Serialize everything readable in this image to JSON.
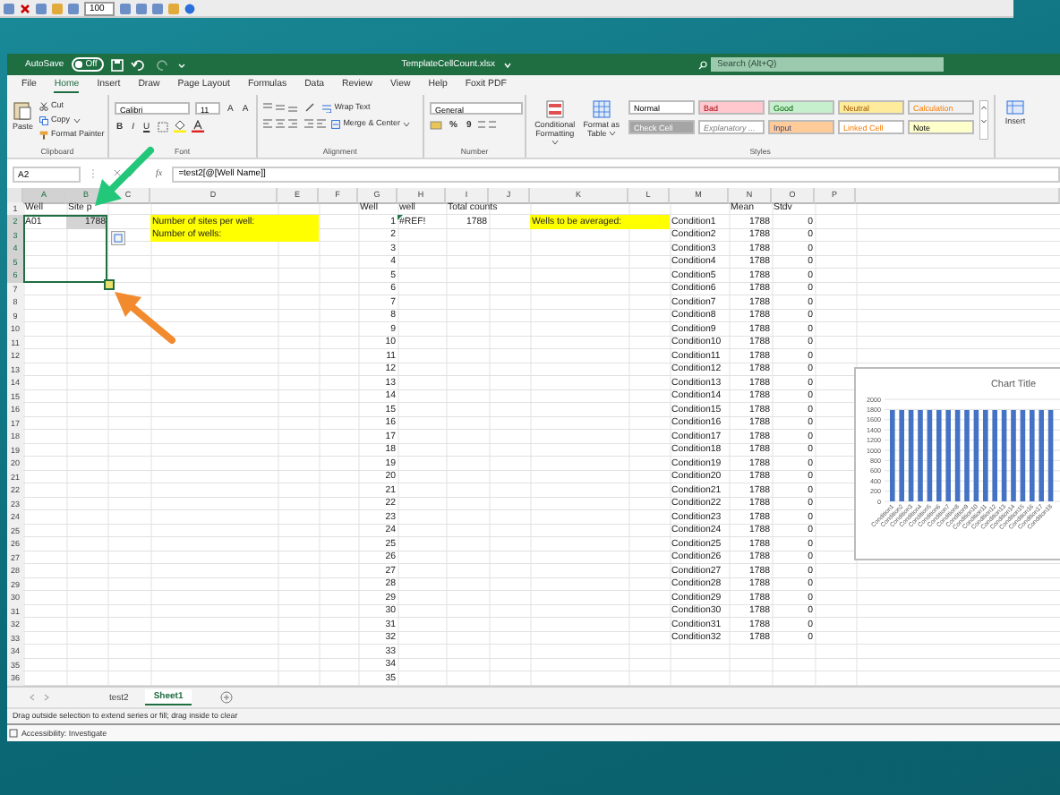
{
  "toolbar": {
    "zoom": "100"
  },
  "window": {
    "autosave_label": "AutoSave",
    "autosave_on": false,
    "autosave_state": "Off",
    "title": "TemplateCellCount.xlsx",
    "search": {
      "placeholder": "Search (Alt+Q)"
    }
  },
  "tabs": [
    {
      "label": "File",
      "selected": false
    },
    {
      "label": "Home",
      "selected": true
    },
    {
      "label": "Insert",
      "selected": false
    },
    {
      "label": "Draw",
      "selected": false
    },
    {
      "label": "Page Layout",
      "selected": false
    },
    {
      "label": "Formulas",
      "selected": false
    },
    {
      "label": "Data",
      "selected": false
    },
    {
      "label": "Review",
      "selected": false
    },
    {
      "label": "View",
      "selected": false
    },
    {
      "label": "Help",
      "selected": false
    },
    {
      "label": "Foxit PDF",
      "selected": false
    }
  ],
  "ribbon": {
    "clipboard": {
      "paste": "Paste",
      "cut": "Cut",
      "copy": "Copy",
      "format_painter": "Format Painter",
      "label": "Clipboard"
    },
    "font": {
      "family": "Calibri",
      "size": "11",
      "size_buttons": [
        "A",
        "A"
      ],
      "format_buttons": [
        "B",
        "I",
        "U"
      ],
      "label": "Font"
    },
    "alignment": {
      "wrap_text": "Wrap Text",
      "merge_center": "Merge & Center",
      "label": "Alignment"
    },
    "number": {
      "format": "General",
      "symbols": [
        "%",
        "9"
      ],
      "label": "Number"
    },
    "styles": {
      "conditional_formatting": "Conditional Formatting",
      "format_as_table": "Format as Table",
      "label": "Styles",
      "cell_styles": [
        {
          "label": "Normal",
          "kind": "normal",
          "color": "#ffffff"
        },
        {
          "label": "Bad",
          "kind": "bad",
          "color": "#ffc7ce"
        },
        {
          "label": "Good",
          "kind": "good",
          "color": "#c6efce"
        },
        {
          "label": "Neutral",
          "kind": "neutral",
          "color": "#ffeb9c"
        },
        {
          "label": "Calculation",
          "kind": "calculation",
          "color": "#f2f2f2"
        },
        {
          "label": "Check Cell",
          "kind": "check",
          "color": "#a5a5a5"
        },
        {
          "label": "Explanatory ...",
          "kind": "explanatory",
          "color": "#ffffff"
        },
        {
          "label": "Input",
          "kind": "input",
          "color": "#ffcc99"
        },
        {
          "label": "Linked Cell",
          "kind": "linked",
          "color": "#ffffff"
        },
        {
          "label": "Note",
          "kind": "note",
          "color": "#ffffcc"
        }
      ]
    },
    "cells": {
      "insert": "Insert"
    }
  },
  "formula_bar": {
    "name_box": "A2",
    "fx": "fx",
    "formula": "=test2[@[Well Name]]"
  },
  "sheet": {
    "columns": {
      "A": {
        "label": "A",
        "selected": true
      },
      "B": {
        "label": "B",
        "selected": true
      },
      "C": {
        "label": "C",
        "selected": false
      },
      "D": {
        "label": "D",
        "selected": false
      },
      "E": {
        "label": "E",
        "selected": false
      },
      "F": {
        "label": "F",
        "selected": false
      },
      "G": {
        "label": "G",
        "selected": false
      },
      "H": {
        "label": "H",
        "selected": false
      },
      "I": {
        "label": "I",
        "selected": false
      },
      "J": {
        "label": "J",
        "selected": false
      },
      "K": {
        "label": "K",
        "selected": false
      },
      "L": {
        "label": "L",
        "selected": false
      },
      "M": {
        "label": "M",
        "selected": false
      },
      "N": {
        "label": "N",
        "selected": false
      },
      "O": {
        "label": "O",
        "selected": false
      },
      "P": {
        "label": "P",
        "selected": false
      }
    },
    "rows": [
      {
        "label": "1",
        "selected": false,
        "cells": {
          "A": {
            "kind": "text",
            "text": "Well"
          },
          "B": {
            "kind": "text",
            "text": "Site p"
          },
          "G": {
            "kind": "text",
            "text": "Well"
          },
          "H": {
            "kind": "text",
            "text": "well"
          },
          "I": {
            "kind": "text",
            "text": "Total counts"
          },
          "N": {
            "kind": "text",
            "text": "Mean"
          },
          "O": {
            "kind": "text",
            "text": "Stdv"
          }
        }
      },
      {
        "label": "2",
        "selected": true,
        "cells": {
          "A": {
            "kind": "text",
            "text": "A01"
          },
          "B": {
            "kind": "number",
            "text": "1788",
            "color": "#d4d4d4"
          },
          "D": {
            "kind": "text",
            "text": "Number of sites per well:",
            "color": "#ffff00"
          },
          "E": {
            "kind": "fill",
            "color": "#ffff00"
          },
          "G": {
            "kind": "number",
            "text": "1"
          },
          "H": {
            "kind": "text",
            "text": "#REF!",
            "error": true
          },
          "I": {
            "kind": "number",
            "text": "1788"
          },
          "K": {
            "kind": "text",
            "text": "Wells to be averaged:",
            "color": "#ffff00"
          },
          "L": {
            "kind": "fill",
            "color": "#ffff00"
          },
          "M": {
            "kind": "text",
            "text": "Condition1"
          },
          "N": {
            "kind": "number",
            "text": "1788"
          },
          "O": {
            "kind": "number",
            "text": "0"
          }
        }
      },
      {
        "label": "3",
        "selected": true,
        "cells": {
          "D": {
            "kind": "text",
            "text": "Number of wells:",
            "color": "#ffff00"
          },
          "E": {
            "kind": "fill",
            "color": "#ffff00"
          },
          "G": {
            "kind": "number",
            "text": "2"
          },
          "M": {
            "kind": "text",
            "text": "Condition2"
          },
          "N": {
            "kind": "number",
            "text": "1788"
          },
          "O": {
            "kind": "number",
            "text": "0"
          }
        }
      },
      {
        "label": "4",
        "selected": true,
        "cells": {
          "G": {
            "kind": "number",
            "text": "3"
          },
          "M": {
            "kind": "text",
            "text": "Condition3"
          },
          "N": {
            "kind": "number",
            "text": "1788"
          },
          "O": {
            "kind": "number",
            "text": "0"
          }
        }
      },
      {
        "label": "5",
        "selected": true,
        "cells": {
          "G": {
            "kind": "number",
            "text": "4"
          },
          "M": {
            "kind": "text",
            "text": "Condition4"
          },
          "N": {
            "kind": "number",
            "text": "1788"
          },
          "O": {
            "kind": "number",
            "text": "0"
          }
        }
      },
      {
        "label": "6",
        "selected": true,
        "cells": {
          "G": {
            "kind": "number",
            "text": "5"
          },
          "M": {
            "kind": "text",
            "text": "Condition5"
          },
          "N": {
            "kind": "number",
            "text": "1788"
          },
          "O": {
            "kind": "number",
            "text": "0"
          }
        }
      },
      {
        "label": "7",
        "selected": false,
        "cells": {
          "G": {
            "kind": "number",
            "text": "6"
          },
          "M": {
            "kind": "text",
            "text": "Condition6"
          },
          "N": {
            "kind": "number",
            "text": "1788"
          },
          "O": {
            "kind": "number",
            "text": "0"
          }
        }
      },
      {
        "label": "8",
        "selected": false,
        "cells": {
          "G": {
            "kind": "number",
            "text": "7"
          },
          "M": {
            "kind": "text",
            "text": "Condition7"
          },
          "N": {
            "kind": "number",
            "text": "1788"
          },
          "O": {
            "kind": "number",
            "text": "0"
          }
        }
      },
      {
        "label": "9",
        "selected": false,
        "cells": {
          "G": {
            "kind": "number",
            "text": "8"
          },
          "M": {
            "kind": "text",
            "text": "Condition8"
          },
          "N": {
            "kind": "number",
            "text": "1788"
          },
          "O": {
            "kind": "number",
            "text": "0"
          }
        }
      },
      {
        "label": "10",
        "selected": false,
        "cells": {
          "G": {
            "kind": "number",
            "text": "9"
          },
          "M": {
            "kind": "text",
            "text": "Condition9"
          },
          "N": {
            "kind": "number",
            "text": "1788"
          },
          "O": {
            "kind": "number",
            "text": "0"
          }
        }
      },
      {
        "label": "11",
        "selected": false,
        "cells": {
          "G": {
            "kind": "number",
            "text": "10"
          },
          "M": {
            "kind": "text",
            "text": "Condition10"
          },
          "N": {
            "kind": "number",
            "text": "1788"
          },
          "O": {
            "kind": "number",
            "text": "0"
          }
        }
      },
      {
        "label": "12",
        "selected": false,
        "cells": {
          "G": {
            "kind": "number",
            "text": "11"
          },
          "M": {
            "kind": "text",
            "text": "Condition11"
          },
          "N": {
            "kind": "number",
            "text": "1788"
          },
          "O": {
            "kind": "number",
            "text": "0"
          }
        }
      },
      {
        "label": "13",
        "selected": false,
        "cells": {
          "G": {
            "kind": "number",
            "text": "12"
          },
          "M": {
            "kind": "text",
            "text": "Condition12"
          },
          "N": {
            "kind": "number",
            "text": "1788"
          },
          "O": {
            "kind": "number",
            "text": "0"
          }
        }
      },
      {
        "label": "14",
        "selected": false,
        "cells": {
          "G": {
            "kind": "number",
            "text": "13"
          },
          "M": {
            "kind": "text",
            "text": "Condition13"
          },
          "N": {
            "kind": "number",
            "text": "1788"
          },
          "O": {
            "kind": "number",
            "text": "0"
          }
        }
      },
      {
        "label": "15",
        "selected": false,
        "cells": {
          "G": {
            "kind": "number",
            "text": "14"
          },
          "M": {
            "kind": "text",
            "text": "Condition14"
          },
          "N": {
            "kind": "number",
            "text": "1788"
          },
          "O": {
            "kind": "number",
            "text": "0"
          }
        }
      },
      {
        "label": "16",
        "selected": false,
        "cells": {
          "G": {
            "kind": "number",
            "text": "15"
          },
          "M": {
            "kind": "text",
            "text": "Condition15"
          },
          "N": {
            "kind": "number",
            "text": "1788"
          },
          "O": {
            "kind": "number",
            "text": "0"
          }
        }
      },
      {
        "label": "17",
        "selected": false,
        "cells": {
          "G": {
            "kind": "number",
            "text": "16"
          },
          "M": {
            "kind": "text",
            "text": "Condition16"
          },
          "N": {
            "kind": "number",
            "text": "1788"
          },
          "O": {
            "kind": "number",
            "text": "0"
          }
        }
      },
      {
        "label": "18",
        "selected": false,
        "cells": {
          "G": {
            "kind": "number",
            "text": "17"
          },
          "M": {
            "kind": "text",
            "text": "Condition17"
          },
          "N": {
            "kind": "number",
            "text": "1788"
          },
          "O": {
            "kind": "number",
            "text": "0"
          }
        }
      },
      {
        "label": "19",
        "selected": false,
        "cells": {
          "G": {
            "kind": "number",
            "text": "18"
          },
          "M": {
            "kind": "text",
            "text": "Condition18"
          },
          "N": {
            "kind": "number",
            "text": "1788"
          },
          "O": {
            "kind": "number",
            "text": "0"
          }
        }
      },
      {
        "label": "20",
        "selected": false,
        "cells": {
          "G": {
            "kind": "number",
            "text": "19"
          },
          "M": {
            "kind": "text",
            "text": "Condition19"
          },
          "N": {
            "kind": "number",
            "text": "1788"
          },
          "O": {
            "kind": "number",
            "text": "0"
          }
        }
      },
      {
        "label": "21",
        "selected": false,
        "cells": {
          "G": {
            "kind": "number",
            "text": "20"
          },
          "M": {
            "kind": "text",
            "text": "Condition20"
          },
          "N": {
            "kind": "number",
            "text": "1788"
          },
          "O": {
            "kind": "number",
            "text": "0"
          }
        }
      },
      {
        "label": "22",
        "selected": false,
        "cells": {
          "G": {
            "kind": "number",
            "text": "21"
          },
          "M": {
            "kind": "text",
            "text": "Condition21"
          },
          "N": {
            "kind": "number",
            "text": "1788"
          },
          "O": {
            "kind": "number",
            "text": "0"
          }
        }
      },
      {
        "label": "23",
        "selected": false,
        "cells": {
          "G": {
            "kind": "number",
            "text": "22"
          },
          "M": {
            "kind": "text",
            "text": "Condition22"
          },
          "N": {
            "kind": "number",
            "text": "1788"
          },
          "O": {
            "kind": "number",
            "text": "0"
          }
        }
      },
      {
        "label": "24",
        "selected": false,
        "cells": {
          "G": {
            "kind": "number",
            "text": "23"
          },
          "M": {
            "kind": "text",
            "text": "Condition23"
          },
          "N": {
            "kind": "number",
            "text": "1788"
          },
          "O": {
            "kind": "number",
            "text": "0"
          }
        }
      },
      {
        "label": "25",
        "selected": false,
        "cells": {
          "G": {
            "kind": "number",
            "text": "24"
          },
          "M": {
            "kind": "text",
            "text": "Condition24"
          },
          "N": {
            "kind": "number",
            "text": "1788"
          },
          "O": {
            "kind": "number",
            "text": "0"
          }
        }
      },
      {
        "label": "26",
        "selected": false,
        "cells": {
          "G": {
            "kind": "number",
            "text": "25"
          },
          "M": {
            "kind": "text",
            "text": "Condition25"
          },
          "N": {
            "kind": "number",
            "text": "1788"
          },
          "O": {
            "kind": "number",
            "text": "0"
          }
        }
      },
      {
        "label": "27",
        "selected": false,
        "cells": {
          "G": {
            "kind": "number",
            "text": "26"
          },
          "M": {
            "kind": "text",
            "text": "Condition26"
          },
          "N": {
            "kind": "number",
            "text": "1788"
          },
          "O": {
            "kind": "number",
            "text": "0"
          }
        }
      },
      {
        "label": "28",
        "selected": false,
        "cells": {
          "G": {
            "kind": "number",
            "text": "27"
          },
          "M": {
            "kind": "text",
            "text": "Condition27"
          },
          "N": {
            "kind": "number",
            "text": "1788"
          },
          "O": {
            "kind": "number",
            "text": "0"
          }
        }
      },
      {
        "label": "29",
        "selected": false,
        "cells": {
          "G": {
            "kind": "number",
            "text": "28"
          },
          "M": {
            "kind": "text",
            "text": "Condition28"
          },
          "N": {
            "kind": "number",
            "text": "1788"
          },
          "O": {
            "kind": "number",
            "text": "0"
          }
        }
      },
      {
        "label": "30",
        "selected": false,
        "cells": {
          "G": {
            "kind": "number",
            "text": "29"
          },
          "M": {
            "kind": "text",
            "text": "Condition29"
          },
          "N": {
            "kind": "number",
            "text": "1788"
          },
          "O": {
            "kind": "number",
            "text": "0"
          }
        }
      },
      {
        "label": "31",
        "selected": false,
        "cells": {
          "G": {
            "kind": "number",
            "text": "30"
          },
          "M": {
            "kind": "text",
            "text": "Condition30"
          },
          "N": {
            "kind": "number",
            "text": "1788"
          },
          "O": {
            "kind": "number",
            "text": "0"
          }
        }
      },
      {
        "label": "32",
        "selected": false,
        "cells": {
          "G": {
            "kind": "number",
            "text": "31"
          },
          "M": {
            "kind": "text",
            "text": "Condition31"
          },
          "N": {
            "kind": "number",
            "text": "1788"
          },
          "O": {
            "kind": "number",
            "text": "0"
          }
        }
      },
      {
        "label": "33",
        "selected": false,
        "cells": {
          "G": {
            "kind": "number",
            "text": "32"
          },
          "M": {
            "kind": "text",
            "text": "Condition32"
          },
          "N": {
            "kind": "number",
            "text": "1788"
          },
          "O": {
            "kind": "number",
            "text": "0"
          }
        }
      },
      {
        "label": "34",
        "selected": false,
        "cells": {
          "G": {
            "kind": "number",
            "text": "33"
          }
        }
      },
      {
        "label": "35",
        "selected": false,
        "cells": {
          "G": {
            "kind": "number",
            "text": "34"
          }
        }
      },
      {
        "label": "36",
        "selected": false,
        "cells": {
          "G": {
            "kind": "number",
            "text": "35"
          }
        }
      }
    ]
  },
  "chart": {
    "chart_data": {
      "type": "bar",
      "title": "Chart Title",
      "categories": [
        "Condition1",
        "Condition2",
        "Condition3",
        "Condition4",
        "Condition5",
        "Condition6",
        "Condition7",
        "Condition8",
        "Condition9",
        "Condition10",
        "Condition11",
        "Condition12",
        "Condition13",
        "Condition14",
        "Condition15",
        "Condition16",
        "Condition17",
        "Condition18"
      ],
      "series": [
        {
          "color": "#4472c4",
          "values": [
            1790,
            1790,
            1790,
            1790,
            1790,
            1790,
            1790,
            1790,
            1790,
            1790,
            1790,
            1790,
            1790,
            1790,
            1790,
            1790,
            1790,
            1790
          ]
        }
      ],
      "grid": true,
      "ylim": [
        0,
        2000
      ],
      "yticks": [
        0,
        200,
        400,
        600,
        800,
        1000,
        1200,
        1400,
        1600,
        1800,
        2000
      ]
    }
  },
  "sheet_tabs": [
    {
      "label": "test2",
      "selected": false
    },
    {
      "label": "Sheet1",
      "selected": true
    }
  ],
  "status_bar": {
    "message": "Drag outside selection to extend series or fill; drag inside to clear",
    "accessibility": "Accessibility: Investigate"
  }
}
